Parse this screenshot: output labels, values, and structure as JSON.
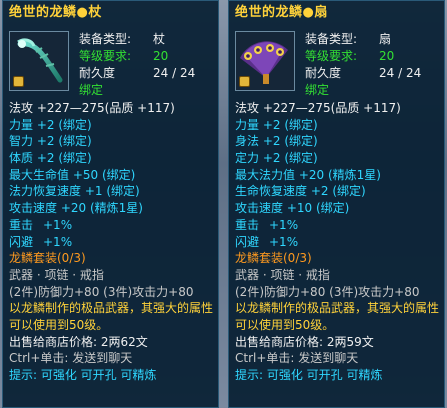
{
  "left": {
    "title": "绝世的龙鳞●杖",
    "type_label": "装备类型:",
    "type_value": "杖",
    "level_label": "等级要求:",
    "level_value": "20",
    "dur_label": "耐久度",
    "dur_value": "24 / 24",
    "bound": "绑定",
    "attack": "法攻    +227—275(品质 +117)",
    "stats": [
      "力量 +2 (绑定)",
      "智力 +2 (绑定)",
      "体质 +2 (绑定)",
      "最大生命值 +50 (绑定)",
      "法力恢复速度 +1 (绑定)",
      "攻击速度 +20 (精炼1星)"
    ],
    "extra": [
      {
        "k": "重击",
        "v": "+1%"
      },
      {
        "k": "闪避",
        "v": "+1%"
      }
    ],
    "set_name": "龙鳞套装(0/3)",
    "set_items": "武器 · 项链 · 戒指",
    "set_bonus": "(2件)防御力+80  (3件)攻击力+80",
    "desc": "以龙鳞制作的极品武器，其强大的属性可以使用到50级。",
    "sell": "出售给商店价格:  2两62文",
    "ctrl": "Ctrl+单击:  发送到聊天",
    "tip": "提示:  可强化 可开孔 可精炼"
  },
  "right": {
    "title": "绝世的龙鳞●扇",
    "type_label": "装备类型:",
    "type_value": "扇",
    "level_label": "等级要求:",
    "level_value": "20",
    "dur_label": "耐久度",
    "dur_value": "24 / 24",
    "bound": "绑定",
    "attack": "法攻    +227—275(品质 +117)",
    "stats": [
      "力量 +2 (绑定)",
      "身法 +2 (绑定)",
      "定力 +2 (绑定)",
      "最大法力值 +20 (精炼1星)",
      "生命恢复速度 +2 (绑定)",
      "攻击速度 +10 (绑定)"
    ],
    "extra": [
      {
        "k": "重击",
        "v": "+1%"
      },
      {
        "k": "闪避",
        "v": "+1%"
      }
    ],
    "set_name": "龙鳞套装(0/3)",
    "set_items": "武器 · 项链 · 戒指",
    "set_bonus": "(2件)防御力+80  (3件)攻击力+80",
    "desc": "以龙鳞制作的极品武器，其强大的属性可以使用到50级。",
    "sell": "出售给商店价格:  2两59文",
    "ctrl": "Ctrl+单击:  发送到聊天",
    "tip": "提示:  可强化 可开孔 可精炼"
  }
}
